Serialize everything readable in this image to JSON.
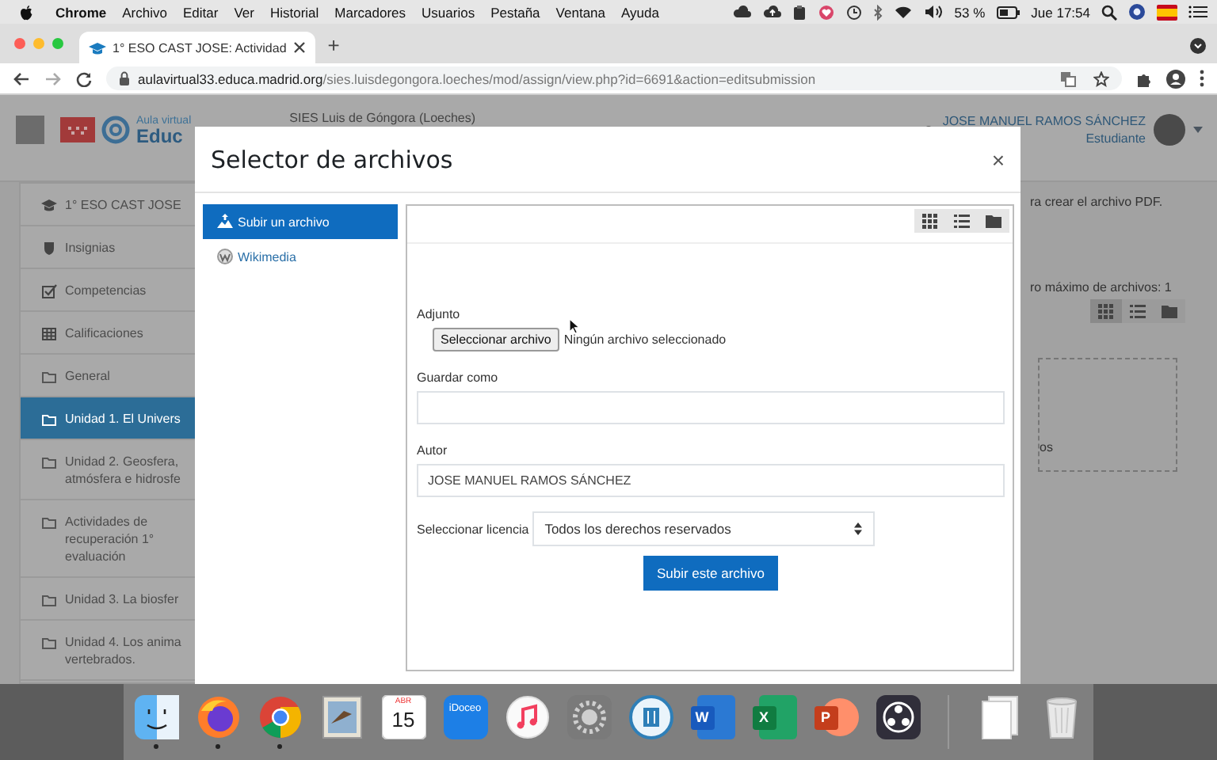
{
  "menu_bar": {
    "app": "Chrome",
    "menus": [
      "Archivo",
      "Editar",
      "Ver",
      "Historial",
      "Marcadores",
      "Usuarios",
      "Pestaña",
      "Ventana",
      "Ayuda"
    ],
    "battery": "53 %",
    "clock": "Jue 17:54"
  },
  "browser": {
    "tab": {
      "title": "1° ESO CAST JOSE: Actividad"
    },
    "new_tab": "+",
    "url": {
      "host": "aulavirtual33.educa.madrid.org",
      "path": "/sies.luisdegongora.loeches/mod/assign/view.php?id=6691&action=editsubmission"
    }
  },
  "site_header": {
    "logo_top": "Aula virtual",
    "logo_bottom": "Educ",
    "site_name": "SIES Luis de Góngora (Loeches)",
    "user_name": "JOSE MANUEL RAMOS SÁNCHEZ",
    "user_role": "Estudiante"
  },
  "sidebar": {
    "items": [
      {
        "label": "1° ESO CAST JOSE",
        "kind": "cap",
        "selected": false
      },
      {
        "label": "Insignias",
        "kind": "badge",
        "selected": false
      },
      {
        "label": "Competencias",
        "kind": "check",
        "selected": false
      },
      {
        "label": "Calificaciones",
        "kind": "table",
        "selected": false
      },
      {
        "label": "General",
        "kind": "folder",
        "selected": false
      },
      {
        "label": "Unidad 1. El Univers",
        "kind": "folder",
        "selected": true
      },
      {
        "label": "Unidad 2. Geosfera, atmósfera e hidrosfe",
        "kind": "folder",
        "selected": false
      },
      {
        "label": "Actividades de recuperación 1° evaluación",
        "kind": "folder",
        "selected": false
      },
      {
        "label": "Unidad 3. La biosfer",
        "kind": "folder",
        "selected": false
      },
      {
        "label": "Unidad 4. Los anima vertebrados.",
        "kind": "folder",
        "selected": false
      }
    ]
  },
  "background_page": {
    "line_1": "ra crear el archivo PDF.",
    "line_2": "ro máximo de archivos: 1",
    "view_buttons": [
      {
        "kind": "grid",
        "selected": true
      },
      {
        "kind": "list",
        "selected": false
      },
      {
        "kind": "folder",
        "selected": false
      }
    ],
    "drop_text": "os"
  },
  "dialog": {
    "title": "Selector de archivos",
    "close": "×",
    "repositories": [
      {
        "label": "Subir un archivo",
        "kind": "upload",
        "selected": true
      },
      {
        "label": "Wikimedia",
        "kind": "wiki",
        "selected": false
      }
    ],
    "view_buttons": [
      {
        "kind": "grid"
      },
      {
        "kind": "list"
      },
      {
        "kind": "folder"
      }
    ],
    "form": {
      "attachment_label": "Adjunto",
      "file_button": "Seleccionar archivo",
      "file_status": "Ningún archivo seleccionado",
      "save_as_label": "Guardar como",
      "author_label": "Autor",
      "author_value": "JOSE MANUEL RAMOS SÁNCHEZ",
      "license_label": "Seleccionar licencia",
      "license_value": "Todos los derechos reservados",
      "submit": "Subir este archivo"
    }
  },
  "dock": {
    "items": [
      {
        "kind": "finder",
        "running": true
      },
      {
        "kind": "firefox",
        "running": true
      },
      {
        "kind": "chrome",
        "running": true
      },
      {
        "kind": "mail",
        "running": false
      },
      {
        "kind": "calendar",
        "label": "ABR",
        "sublabel": "15",
        "running": false
      },
      {
        "kind": "idoceo",
        "label": "iDoceo",
        "running": false
      },
      {
        "kind": "music",
        "running": false
      },
      {
        "kind": "prefs",
        "running": false
      },
      {
        "kind": "archive",
        "running": false
      },
      {
        "kind": "word",
        "label": "W",
        "running": false
      },
      {
        "kind": "excel",
        "label": "X",
        "running": false
      },
      {
        "kind": "powerpoint",
        "label": "P",
        "running": false
      },
      {
        "kind": "obs",
        "running": false
      },
      {
        "kind": "separator"
      },
      {
        "kind": "documents",
        "running": false
      },
      {
        "kind": "trash",
        "running": false
      }
    ]
  }
}
